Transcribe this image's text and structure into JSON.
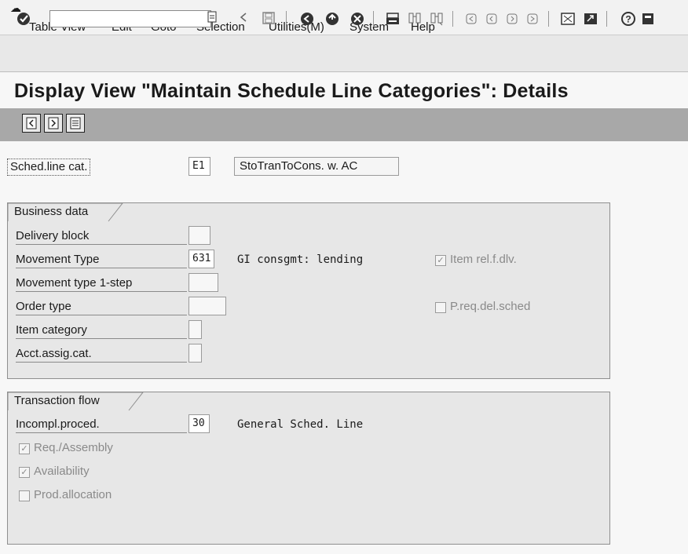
{
  "menu": {
    "items": [
      "Table View",
      "Edit",
      "Goto",
      "Selection",
      "Utilities(M)",
      "System",
      "Help"
    ]
  },
  "toolbar": {
    "command_field_value": "",
    "icons": [
      "enter-icon",
      "save-icon",
      "back-icon",
      "exit-icon",
      "cancel-icon",
      "print-icon",
      "find-icon",
      "find-next-icon",
      "first-page-icon",
      "previous-page-icon",
      "next-page-icon",
      "last-page-icon",
      "create-session-icon",
      "shortcut-icon",
      "help-icon",
      "customize-layout-icon"
    ]
  },
  "page": {
    "title": "Display View \"Maintain Schedule Line Categories\": Details"
  },
  "header": {
    "sched_line_label": "Sched.line cat.",
    "sched_line_value": "E1",
    "sched_line_desc": "StoTranToCons. w. AC"
  },
  "business": {
    "title": "Business data",
    "delivery_block_label": "Delivery block",
    "delivery_block_value": "",
    "movement_type_label": "Movement Type",
    "movement_type_value": "631",
    "movement_type_desc": "GI consgmt: lending",
    "movement_1step_label": "Movement type 1-step",
    "movement_1step_value": "",
    "order_type_label": "Order type",
    "order_type_value": "",
    "item_category_label": "Item category",
    "item_category_value": "",
    "acct_assig_label": "Acct.assig.cat.",
    "acct_assig_value": "",
    "item_rel_label": "Item rel.f.dlv.",
    "item_rel_checked": true,
    "preq_label": "P.req.del.sched",
    "preq_checked": false
  },
  "transaction": {
    "title": "Transaction flow",
    "incompl_label": "Incompl.proced.",
    "incompl_value": "30",
    "incompl_desc": "General Sched. Line",
    "req_assembly_label": "Req./Assembly",
    "req_assembly_checked": true,
    "availability_label": "Availability",
    "availability_checked": true,
    "prod_alloc_label": "Prod.allocation",
    "prod_alloc_checked": false
  }
}
